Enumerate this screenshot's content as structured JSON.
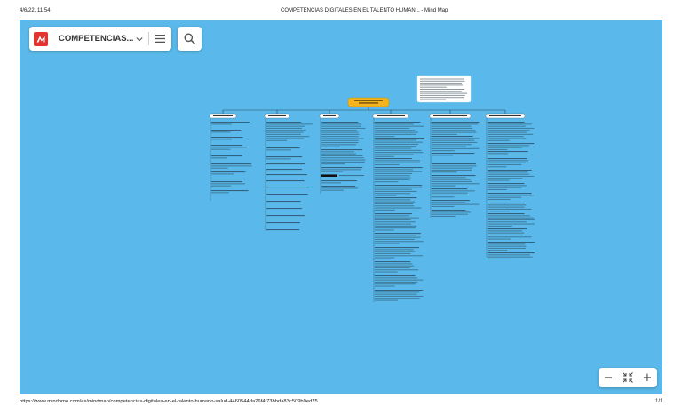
{
  "browser": {
    "date": "4/6/22, 11:54",
    "title": "COMPETENCIAS DIGITALES EN EL TALENTO HUMAN... - Mind Map",
    "url": "https://www.mindomo.com/es/mindmap/competencias-digitales-en-el-talento-humano-salud-4460544da26f4f73bbda83c509b9ed75",
    "page": "1/1"
  },
  "toolbar": {
    "logo_icon": "mindomo-logo-icon",
    "map_title": "COMPETENCIAS...",
    "dropdown_icon": "chevron-down-icon",
    "menu_icon": "hamburger-menu-icon",
    "search_icon": "search-icon"
  },
  "zoom": {
    "zoom_out_label": "−",
    "fit_icon": "fit-to-screen-icon",
    "zoom_in_label": "+"
  },
  "colors": {
    "canvas": "#5ab9ea",
    "central_topic": "#f5b41e",
    "logo": "#e2332f"
  }
}
